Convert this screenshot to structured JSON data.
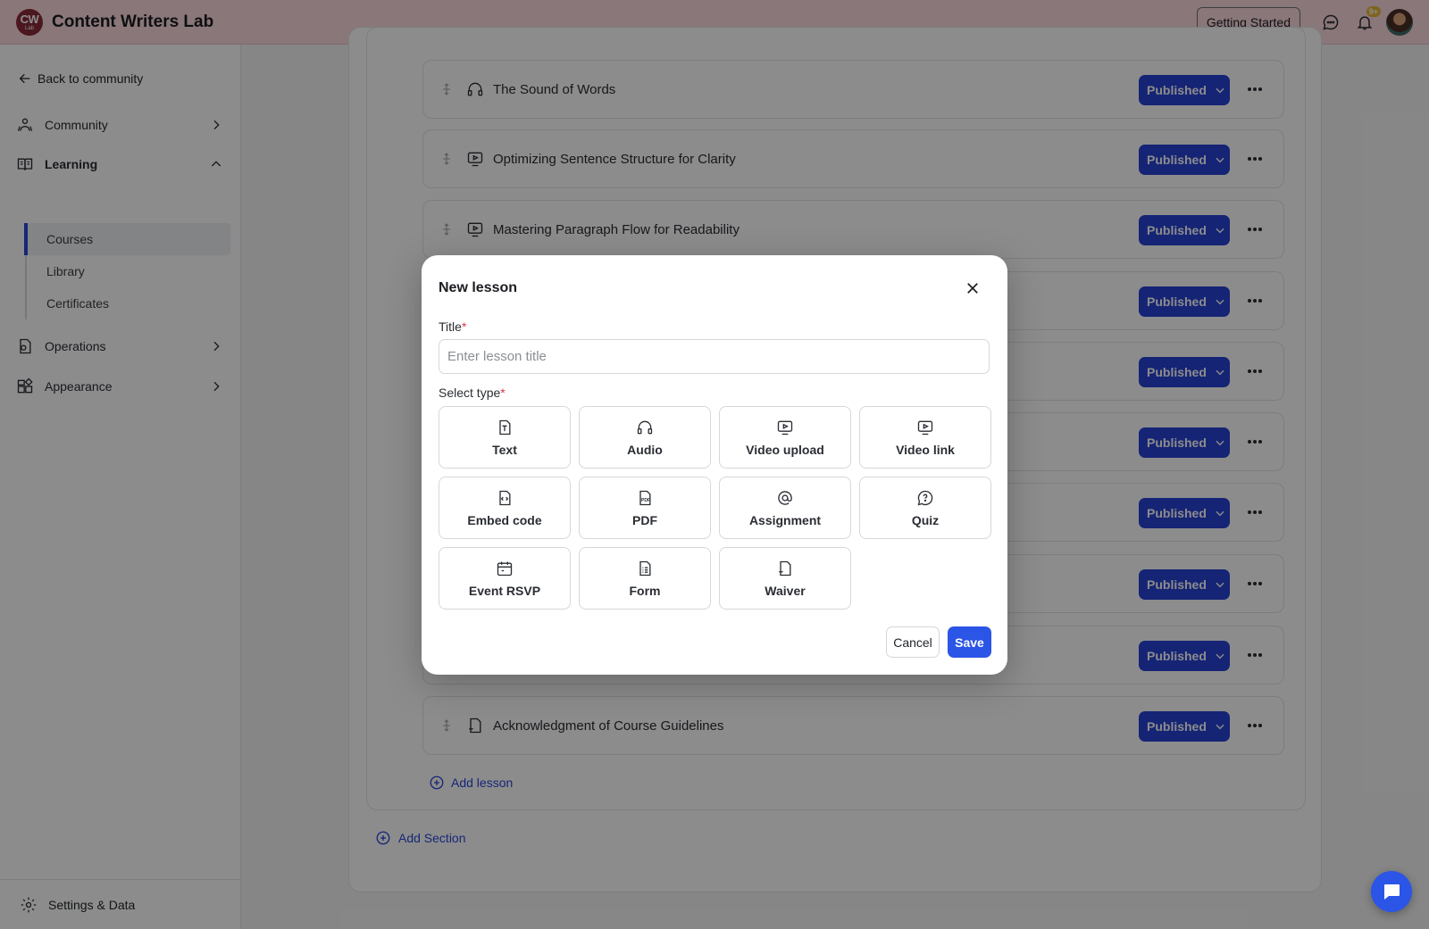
{
  "header": {
    "logo_big": "CW",
    "logo_small": "Lab",
    "app_title": "Content Writers Lab",
    "getting_started_label": "Getting Started",
    "notification_badge": "9+",
    "background_color": "#fcd9dc"
  },
  "sidebar": {
    "back_label": "Back to community",
    "items": [
      {
        "label": "Community",
        "icon": "community-icon",
        "expanded": false
      },
      {
        "label": "Learning",
        "icon": "book-icon",
        "expanded": true
      },
      {
        "label": "Operations",
        "icon": "operations-icon",
        "expanded": false
      },
      {
        "label": "Appearance",
        "icon": "appearance-icon",
        "expanded": false
      }
    ],
    "learning_subitems": [
      {
        "label": "Courses",
        "active": true
      },
      {
        "label": "Library",
        "active": false
      },
      {
        "label": "Certificates",
        "active": false
      }
    ],
    "settings_label": "Settings & Data"
  },
  "lessons": [
    {
      "name": "The Sound of Words",
      "icon": "audio-icon",
      "status": "Published"
    },
    {
      "name": "Optimizing Sentence Structure for Clarity",
      "icon": "video-icon",
      "status": "Published"
    },
    {
      "name": "Mastering Paragraph Flow for Readability",
      "icon": "video-icon",
      "status": "Published"
    },
    {
      "name": "",
      "icon": "",
      "status": "Published"
    },
    {
      "name": "",
      "icon": "",
      "status": "Published"
    },
    {
      "name": "",
      "icon": "",
      "status": "Published"
    },
    {
      "name": "",
      "icon": "",
      "status": "Published"
    },
    {
      "name": "",
      "icon": "",
      "status": "Published"
    },
    {
      "name": "",
      "icon": "",
      "status": "Published"
    },
    {
      "name": "Acknowledgment of Course Guidelines",
      "icon": "waiver-icon",
      "status": "Published"
    }
  ],
  "add_lesson_label": "Add lesson",
  "add_section_label": "Add Section",
  "modal": {
    "title": "New lesson",
    "title_label": "Title",
    "title_placeholder": "Enter lesson title",
    "title_value": "",
    "type_label": "Select type",
    "required_mark": "*",
    "types": [
      {
        "label": "Text",
        "icon": "text-doc-icon"
      },
      {
        "label": "Audio",
        "icon": "headphones-icon"
      },
      {
        "label": "Video upload",
        "icon": "video-upload-icon"
      },
      {
        "label": "Video link",
        "icon": "video-link-icon"
      },
      {
        "label": "Embed code",
        "icon": "embed-code-icon"
      },
      {
        "label": "PDF",
        "icon": "pdf-icon"
      },
      {
        "label": "Assignment",
        "icon": "at-sign-icon"
      },
      {
        "label": "Quiz",
        "icon": "quiz-icon"
      },
      {
        "label": "Event RSVP",
        "icon": "calendar-icon"
      },
      {
        "label": "Form",
        "icon": "form-icon"
      },
      {
        "label": "Waiver",
        "icon": "waiver-icon"
      }
    ],
    "cancel_label": "Cancel",
    "save_label": "Save"
  },
  "colors": {
    "accent": "#2b55e6",
    "published": "#2742d6",
    "required": "#e0364b"
  }
}
